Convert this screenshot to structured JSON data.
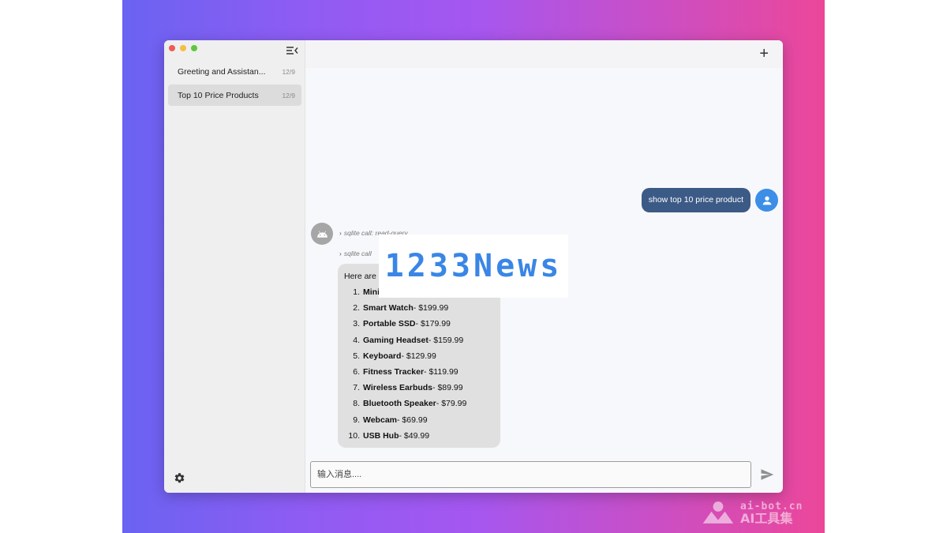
{
  "sidebar": {
    "conversations": [
      {
        "title": "Greeting and Assistan...",
        "date": "12/9",
        "active": false
      },
      {
        "title": "Top 10 Price Products",
        "date": "12/9",
        "active": true
      }
    ]
  },
  "chat": {
    "user_message": "show top 10 price product",
    "tool_calls": [
      {
        "label": "sqlite call: read-query"
      },
      {
        "label": "sqlite call"
      }
    ],
    "answer_intro": "Here are",
    "products": [
      {
        "num": "1.",
        "name": "Mini",
        "price": ""
      },
      {
        "num": "2.",
        "name": "Smart Watch",
        "price": " - $199.99"
      },
      {
        "num": "3.",
        "name": "Portable SSD",
        "price": " - $179.99"
      },
      {
        "num": "4.",
        "name": "Gaming Headset",
        "price": " - $159.99"
      },
      {
        "num": "5.",
        "name": "Keyboard",
        "price": " - $129.99"
      },
      {
        "num": "6.",
        "name": "Fitness Tracker",
        "price": " - $119.99"
      },
      {
        "num": "7.",
        "name": "Wireless Earbuds",
        "price": " - $89.99"
      },
      {
        "num": "8.",
        "name": "Bluetooth Speaker",
        "price": " - $79.99"
      },
      {
        "num": "9.",
        "name": "Webcam",
        "price": " - $69.99"
      },
      {
        "num": "10.",
        "name": "USB Hub",
        "price": " - $49.99"
      }
    ]
  },
  "input": {
    "placeholder": "输入消息...."
  },
  "overlay": {
    "watermark_text": "1233News",
    "site_url": "ai-bot.cn",
    "site_name": "AI工具集"
  },
  "icons": {
    "collapse": "sidebar-collapse-icon",
    "new_chat": "plus-icon",
    "settings": "gear-icon",
    "user_avatar": "person-icon",
    "bot_avatar": "android-icon",
    "send": "send-icon"
  },
  "colors": {
    "user_bubble": "#3c5a86",
    "user_avatar": "#3d8ee6",
    "assistant_bubble": "#e0e0e0"
  }
}
